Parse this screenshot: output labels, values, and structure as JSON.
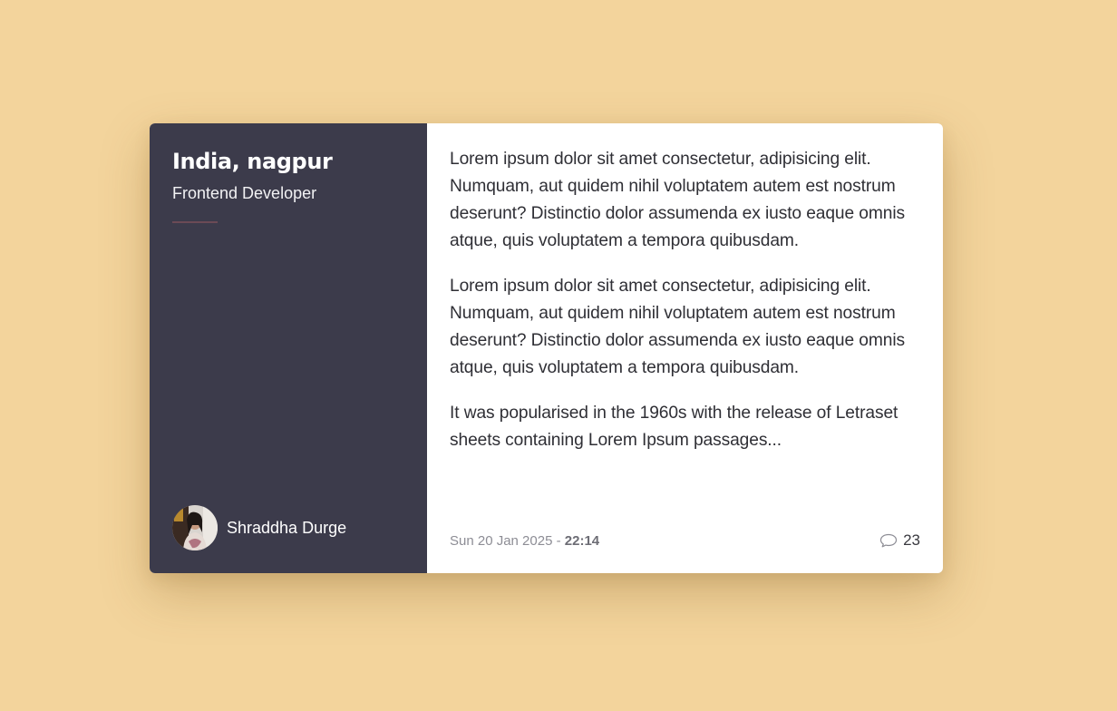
{
  "sidebar": {
    "location": "India, nagpur",
    "role": "Frontend Developer",
    "author_name": "Shraddha Durge"
  },
  "content": {
    "paragraphs": [
      "Lorem ipsum dolor sit amet consectetur, adipisicing elit. Numquam, aut quidem nihil voluptatem autem est nostrum deserunt? Distinctio dolor assumenda ex iusto eaque omnis atque, quis voluptatem a tempora quibusdam.",
      "Lorem ipsum dolor sit amet consectetur, adipisicing elit. Numquam, aut quidem nihil voluptatem autem est nostrum deserunt? Distinctio dolor assumenda ex iusto eaque omnis atque, quis voluptatem a tempora quibusdam.",
      "It was popularised in the 1960s with the release of Letraset sheets containing Lorem Ipsum passages..."
    ]
  },
  "meta": {
    "date": "Sun 20 Jan 2025 - ",
    "time": "22:14",
    "comment_count": "23",
    "comment_icon": "speech-bubble-icon"
  },
  "colors": {
    "background": "#f3d49c",
    "sidebar": "#3c3b4b",
    "accent_divider": "#6b4a55"
  }
}
